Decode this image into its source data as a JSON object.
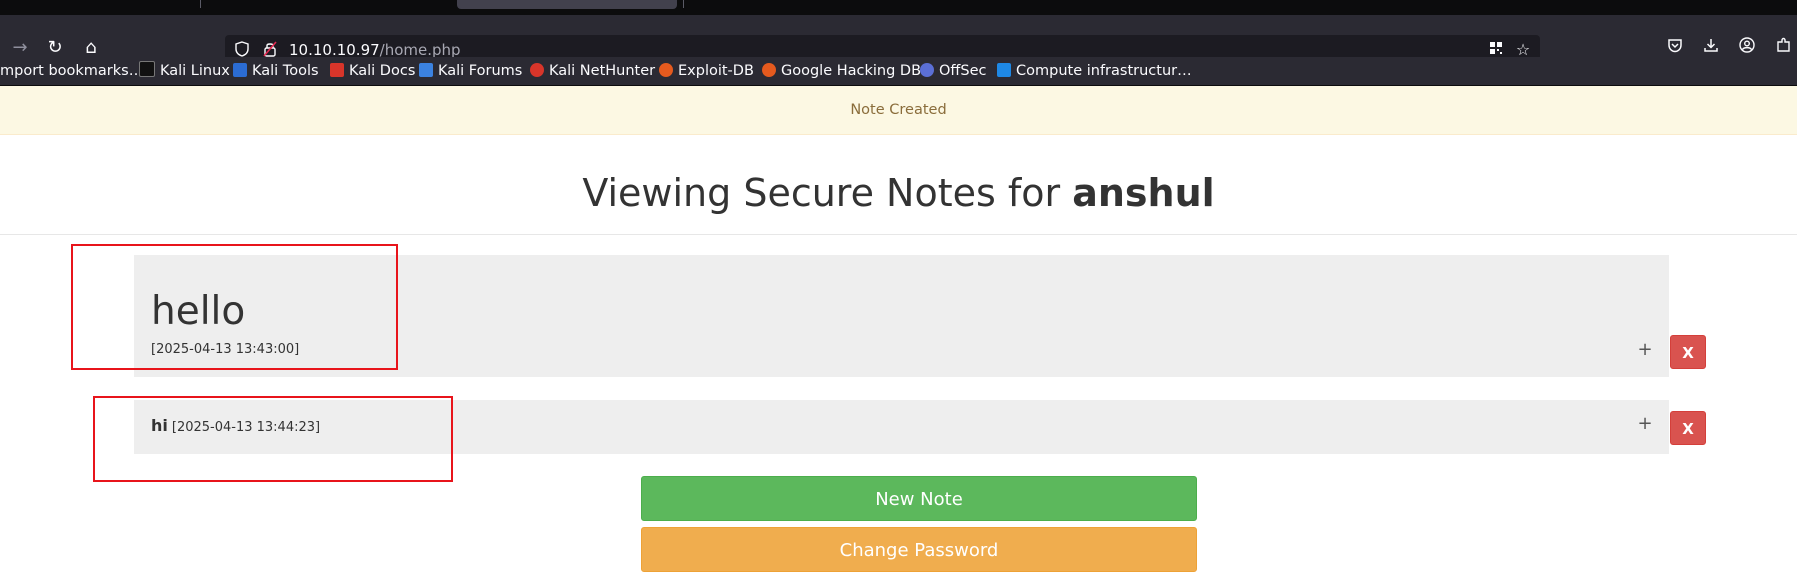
{
  "browser": {
    "url_host": "10.10.10.97",
    "url_path": "/home.php",
    "bookmarks": [
      {
        "label": "mport bookmarks…",
        "icon": "folder-icon"
      },
      {
        "label": "Kali Linux",
        "icon": "kali-dragon-icon",
        "color": "#111111"
      },
      {
        "label": "Kali Tools",
        "icon": "kali-tools-icon",
        "color": "#2b6cd4"
      },
      {
        "label": "Kali Docs",
        "icon": "kali-docs-icon",
        "color": "#d8352a"
      },
      {
        "label": "Kali Forums",
        "icon": "kali-forums-icon",
        "color": "#3b82e0"
      },
      {
        "label": "Kali NetHunter",
        "icon": "kali-nethunter-icon",
        "color": "#d8352a"
      },
      {
        "label": "Exploit-DB",
        "icon": "exploit-db-icon",
        "color": "#e55a1e"
      },
      {
        "label": "Google Hacking DB",
        "icon": "ghdb-icon",
        "color": "#e55a1e"
      },
      {
        "label": "OffSec",
        "icon": "offsec-icon",
        "color": "#5b6fd6"
      },
      {
        "label": "Compute infrastructur…",
        "icon": "azure-icon",
        "color": "#1e88e5"
      }
    ]
  },
  "alert": {
    "text": "Note Created"
  },
  "header": {
    "prefix": "Viewing Secure Notes for ",
    "username": "anshul"
  },
  "notes": [
    {
      "title": "hello",
      "date": "[2025-04-13 13:43:00]",
      "expand": "+",
      "delete": "X"
    },
    {
      "title": "hi",
      "date": "[2025-04-13 13:44:23]",
      "expand": "+",
      "delete": "X"
    }
  ],
  "actions": {
    "new_note": "New Note",
    "change_password": "Change Password"
  },
  "colors": {
    "annotation": "#e8141b",
    "success": "#5cb85c",
    "warning": "#f0ad4e",
    "danger": "#d9534f"
  }
}
